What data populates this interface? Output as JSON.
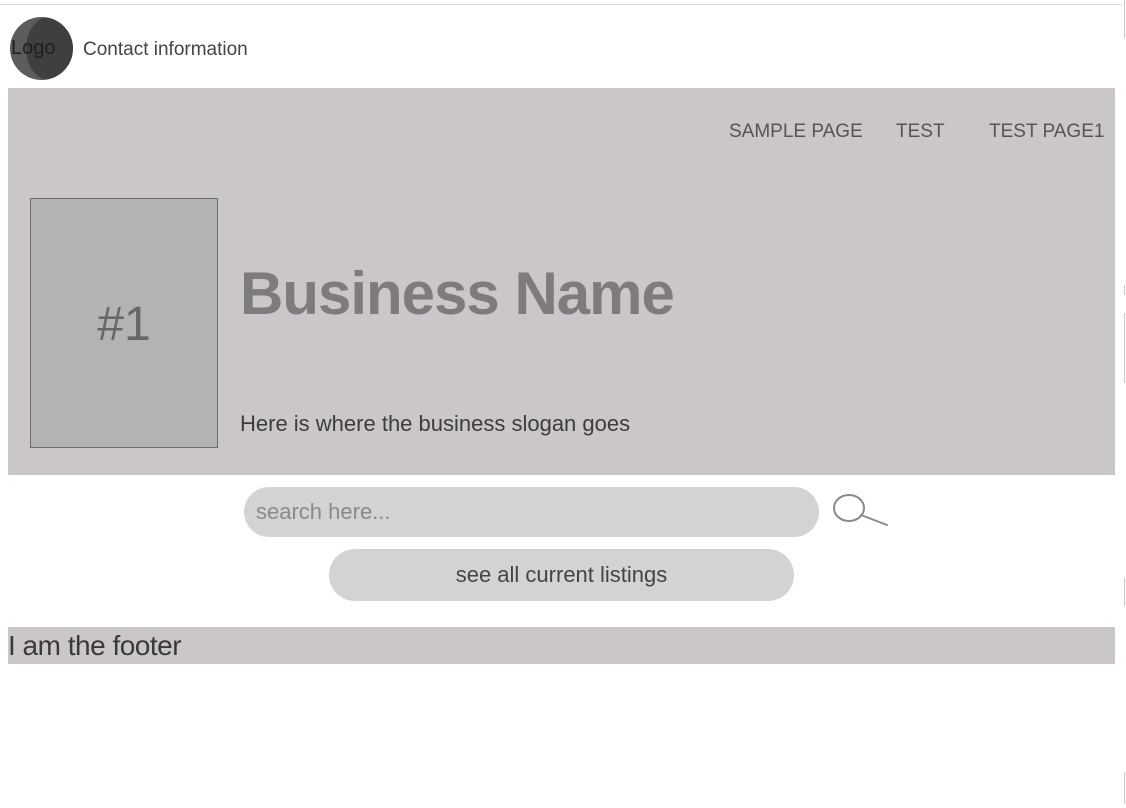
{
  "header": {
    "logo_text": "Logo",
    "contact_label": "Contact information"
  },
  "nav": {
    "items": [
      {
        "label": "SAMPLE PAGE"
      },
      {
        "label": "TEST"
      },
      {
        "label": "TEST PAGE1"
      }
    ]
  },
  "hero": {
    "photo_label": "#1",
    "business_name": "Business Name",
    "slogan": "Here is where the business slogan goes"
  },
  "search": {
    "placeholder": "search here...",
    "value": "",
    "icon": "search-icon",
    "listings_button_label": "see all current listings"
  },
  "footer": {
    "text": "I am the footer"
  },
  "colors": {
    "hero_background": "#cbc6c9",
    "photo_background": "#b3b3b3",
    "input_background": "#d3d3d3",
    "business_name": "#7d7b7c"
  }
}
